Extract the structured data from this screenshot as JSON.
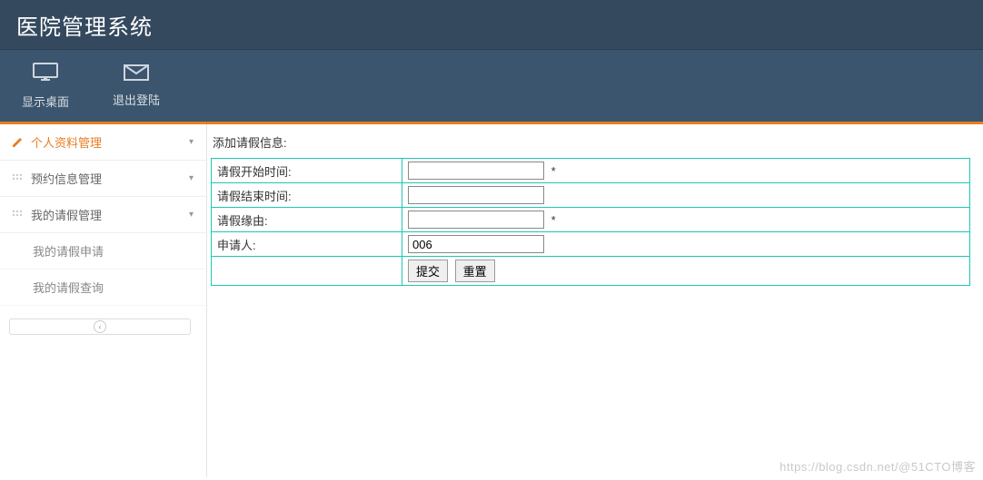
{
  "header": {
    "title": "医院管理系统"
  },
  "toolbar": {
    "desktop_label": "显示桌面",
    "logout_label": "退出登陆"
  },
  "sidebar": {
    "items": [
      {
        "label": "个人资料管理",
        "active": true
      },
      {
        "label": "预约信息管理",
        "active": false
      },
      {
        "label": "我的请假管理",
        "active": false
      }
    ],
    "subitems": [
      {
        "label": "我的请假申请"
      },
      {
        "label": "我的请假查询"
      }
    ]
  },
  "form": {
    "title": "添加请假信息:",
    "rows": [
      {
        "label": "请假开始时间:",
        "value": "",
        "required": true
      },
      {
        "label": "请假结束时间:",
        "value": "",
        "required": false
      },
      {
        "label": "请假缘由:",
        "value": "",
        "required": true
      },
      {
        "label": "申请人:",
        "value": "006",
        "required": false
      }
    ],
    "buttons": {
      "submit": "提交",
      "reset": "重置"
    },
    "required_mark": "*"
  },
  "watermark": "https://blog.csdn.net/@51CTO博客"
}
